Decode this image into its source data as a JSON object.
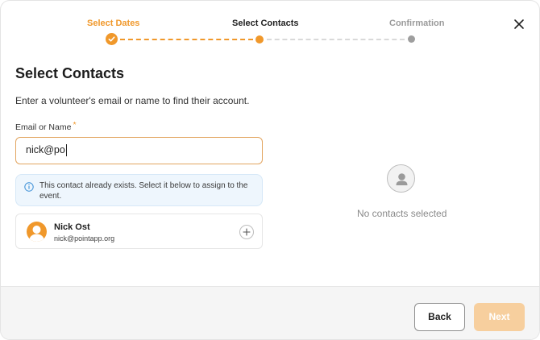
{
  "stepper": {
    "steps": [
      {
        "label": "Select Dates",
        "state": "completed"
      },
      {
        "label": "Select Contacts",
        "state": "active"
      },
      {
        "label": "Confirmation",
        "state": "pending"
      }
    ]
  },
  "close_icon": "close-icon",
  "page": {
    "title": "Select Contacts",
    "subtitle": "Enter a volunteer's email or name to find their account."
  },
  "search": {
    "label": "Email or Name",
    "required_mark": "*",
    "value": "nick@po"
  },
  "notice": {
    "icon": "info-icon",
    "text": "This contact already exists. Select it below to assign to the event."
  },
  "results": [
    {
      "name": "Nick Ost",
      "email": "nick@pointapp.org",
      "action_icon": "plus-icon"
    }
  ],
  "selected_panel": {
    "icon": "person-icon",
    "empty_text": "No contacts selected"
  },
  "footer": {
    "back_label": "Back",
    "next_label": "Next"
  },
  "colors": {
    "accent": "#f0982b",
    "accent_disabled": "#f7cf9e",
    "pending": "#9e9e9e",
    "notice_bg": "#eef6fd",
    "info": "#3b8fd6"
  }
}
